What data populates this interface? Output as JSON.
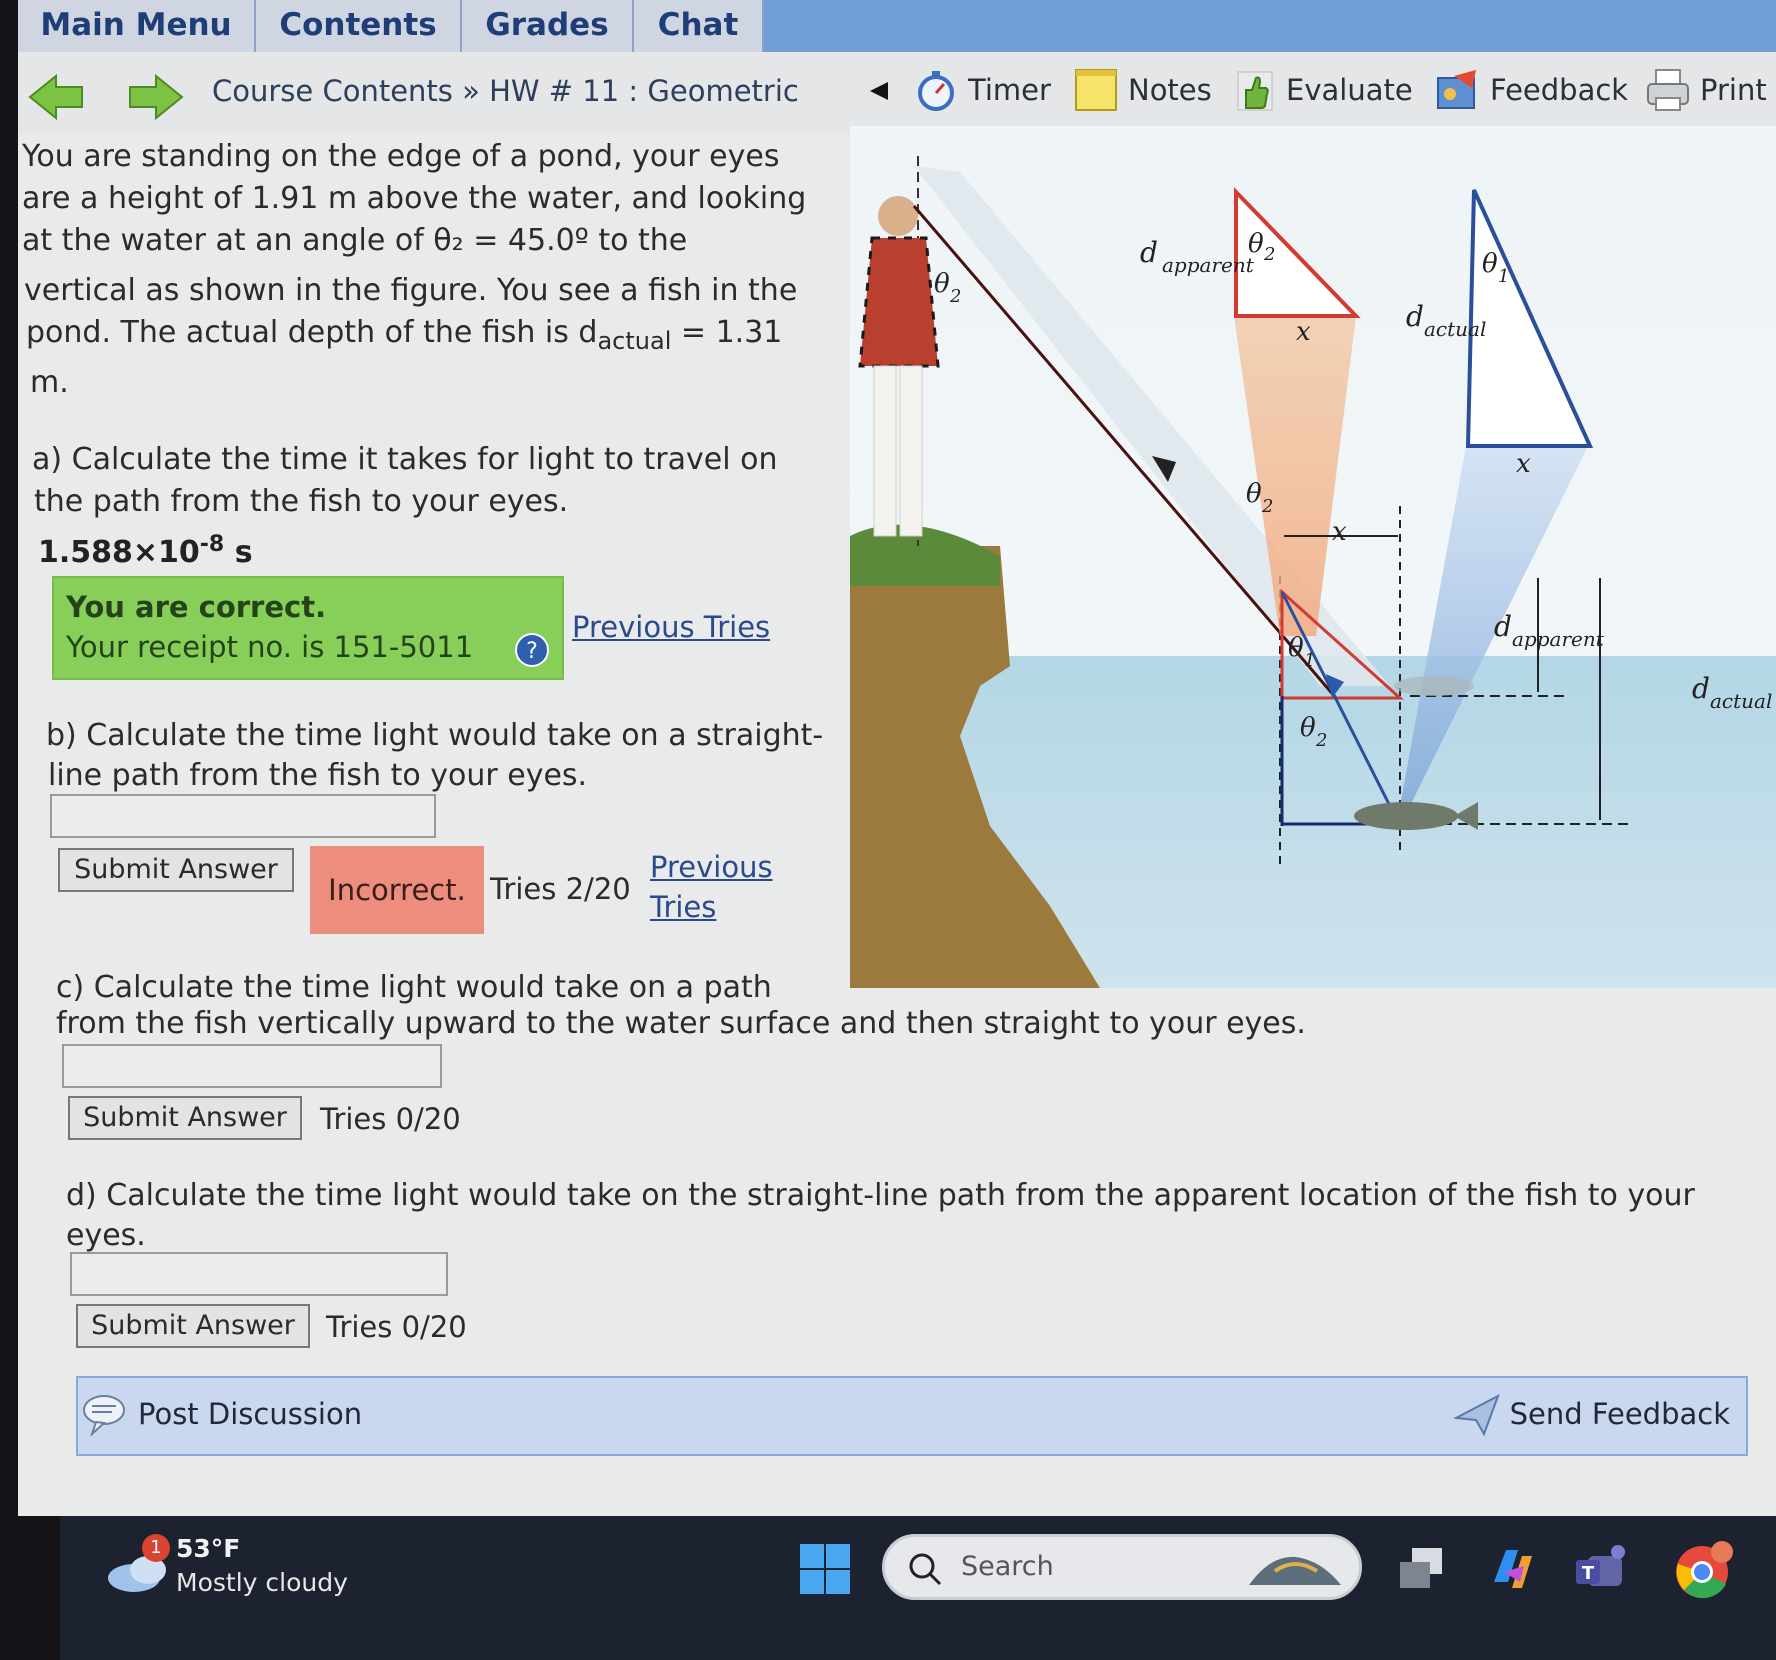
{
  "tabs": [
    "Main Menu",
    "Contents",
    "Grades",
    "Chat"
  ],
  "breadcrumb": "Course Contents » HW # 11 : Geometric",
  "tools": {
    "timer": "Timer",
    "notes": "Notes",
    "evaluate": "Evaluate",
    "feedback": "Feedback",
    "print": "Print"
  },
  "problem": {
    "lines": [
      "You are standing on the edge of a pond, your eyes",
      "are a height of 1.91 m above the water, and looking",
      "at the water at an angle of θ₂ = 45.0º to the",
      "vertical as shown in the figure. You see a fish in the",
      "pond. The actual depth of the fish is d",
      "m."
    ],
    "dactual_value": "= 1.31",
    "dactual_sub": "actual"
  },
  "part_a": {
    "question_l1": "a) Calculate the time it takes for light to travel on",
    "question_l2": "the path from the fish to your eyes.",
    "answer_mantissa": "1.588×10",
    "answer_exp": "-8",
    "answer_unit": "s",
    "correct_title": "You are correct.",
    "receipt": "Your receipt no. is 151-5011",
    "previous_tries": "Previous Tries"
  },
  "part_b": {
    "question_l1": "b) Calculate the time light would take on a straight-",
    "question_l2": "line path from the fish to your eyes.",
    "input_value": "",
    "submit": "Submit Answer",
    "status": "Incorrect.",
    "tries": "Tries 2/20",
    "previous_l1": "Previous",
    "previous_l2": "Tries"
  },
  "part_c": {
    "question_l1": "c) Calculate the time light would take on a path",
    "question_l2": "from the fish vertically upward to the water surface and then straight to your eyes.",
    "input_value": "",
    "submit": "Submit Answer",
    "tries": "Tries 0/20"
  },
  "part_d": {
    "question_l1": "d) Calculate the time light would take on the straight-line path from the apparent location of the fish to your",
    "question_l2": "eyes.",
    "input_value": "",
    "submit": "Submit Answer",
    "tries": "Tries 0/20"
  },
  "figure": {
    "labels": {
      "theta1": "θ",
      "theta2": "θ",
      "sub1": "1",
      "sub2": "2",
      "d": "d",
      "apparent": "apparent",
      "actual": "actual",
      "x": "x"
    },
    "colors": {
      "red_triangle": "#d23a32",
      "blue_triangle": "#2a4f9b",
      "water": "#a9cde0",
      "cliff": "#9c7a3e"
    }
  },
  "discussion": {
    "post": "Post Discussion",
    "send": "Send Feedback"
  },
  "taskbar": {
    "weather_badge": "1",
    "temperature": "53°F",
    "condition": "Mostly cloudy",
    "search_placeholder": "Search"
  }
}
